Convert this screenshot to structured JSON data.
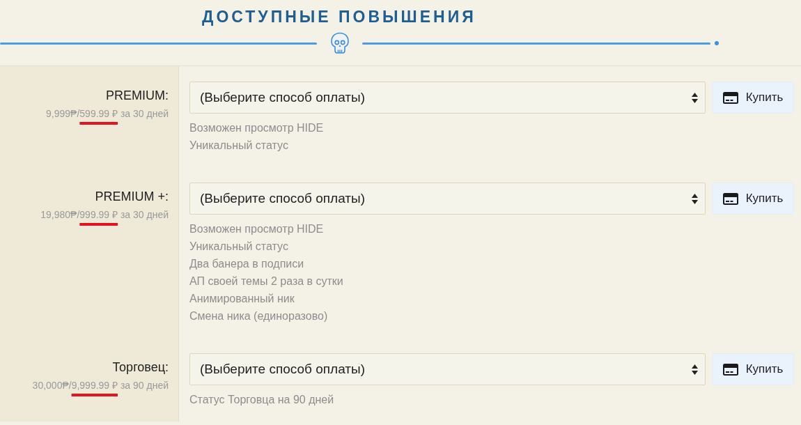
{
  "header": {
    "title": "ДОСТУПНЫЕ ПОВЫШЕНИЯ"
  },
  "plans": [
    {
      "name": "PREMIUM:",
      "old_price": "9,999₱/",
      "new_price": "599.99 ₽",
      "period": "за 30 дней",
      "underlined": true,
      "payment_select": {
        "value": "(Выберите способ оплаты)"
      },
      "buy_button": "Купить",
      "features": [
        "Возможен просмотр HIDE",
        "Уникальный статус"
      ]
    },
    {
      "name": "PREMIUM +:",
      "old_price": "19,980₱/",
      "new_price": "999.99 ₽",
      "period": "за 30 дней",
      "underlined": true,
      "payment_select": {
        "value": "(Выберите способ оплаты)"
      },
      "buy_button": "Купить",
      "features": [
        "Возможен просмотр HIDE",
        "Уникальный статус",
        "Два банера в подписи",
        "АП своей темы 2 раза в сутки",
        "Анимированный ник",
        "Смена ника (единоразово)"
      ]
    },
    {
      "name": "Торговец:",
      "old_price": "30,000₱/",
      "new_price": "9,999.99 ₽",
      "period": "за 90 дней",
      "underlined": true,
      "payment_select": {
        "value": "(Выберите способ оплаты)"
      },
      "buy_button": "Купить",
      "features": [
        "Статус Торговца на 90 дней"
      ]
    }
  ]
}
